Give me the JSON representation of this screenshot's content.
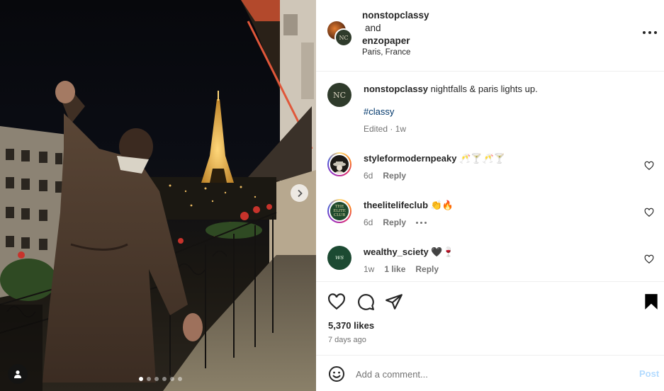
{
  "post": {
    "authors": {
      "first": "nonstopclassy",
      "joiner": "and",
      "second": "enzopaper"
    },
    "location": "Paris, France",
    "collab_avatar_text": "NC",
    "caption": {
      "username": "nonstopclassy",
      "text": "nightfalls & paris lights up.",
      "hashtag": "#classy",
      "meta": "Edited · 1w",
      "avatar_text": "NC"
    },
    "likes": "5,370 likes",
    "posted": "7 days ago",
    "carousel": {
      "count": 6,
      "active_index": 0
    }
  },
  "comments": [
    {
      "username": "styleformodernpeaky",
      "text": "🥂🍸🥂🍸",
      "age": "6d",
      "reply": "Reply",
      "avatar": "hat-avatar"
    },
    {
      "username": "theelitelifeclub",
      "text": "👏🔥",
      "age": "6d",
      "reply": "Reply",
      "avatar_text": "THE ELITE CLUB",
      "more": "more-options"
    },
    {
      "username": "wealthy_sciety",
      "text": "🖤🍷",
      "age": "1w",
      "likes": "1 like",
      "reply": "Reply",
      "avatar_text": "ws"
    }
  ],
  "add_comment": {
    "placeholder": "Add a comment...",
    "post_label": "Post"
  },
  "icons": [
    "like-icon",
    "comment-icon",
    "share-icon",
    "save-icon",
    "emoji-icon",
    "more-icon",
    "chevron-right-icon",
    "user-tag-icon"
  ],
  "colors": {
    "hashtag": "#00376b",
    "muted": "#737373",
    "post_disabled": "#b3dbff",
    "ring_start": "#feda75",
    "ring_end": "#d62976"
  }
}
